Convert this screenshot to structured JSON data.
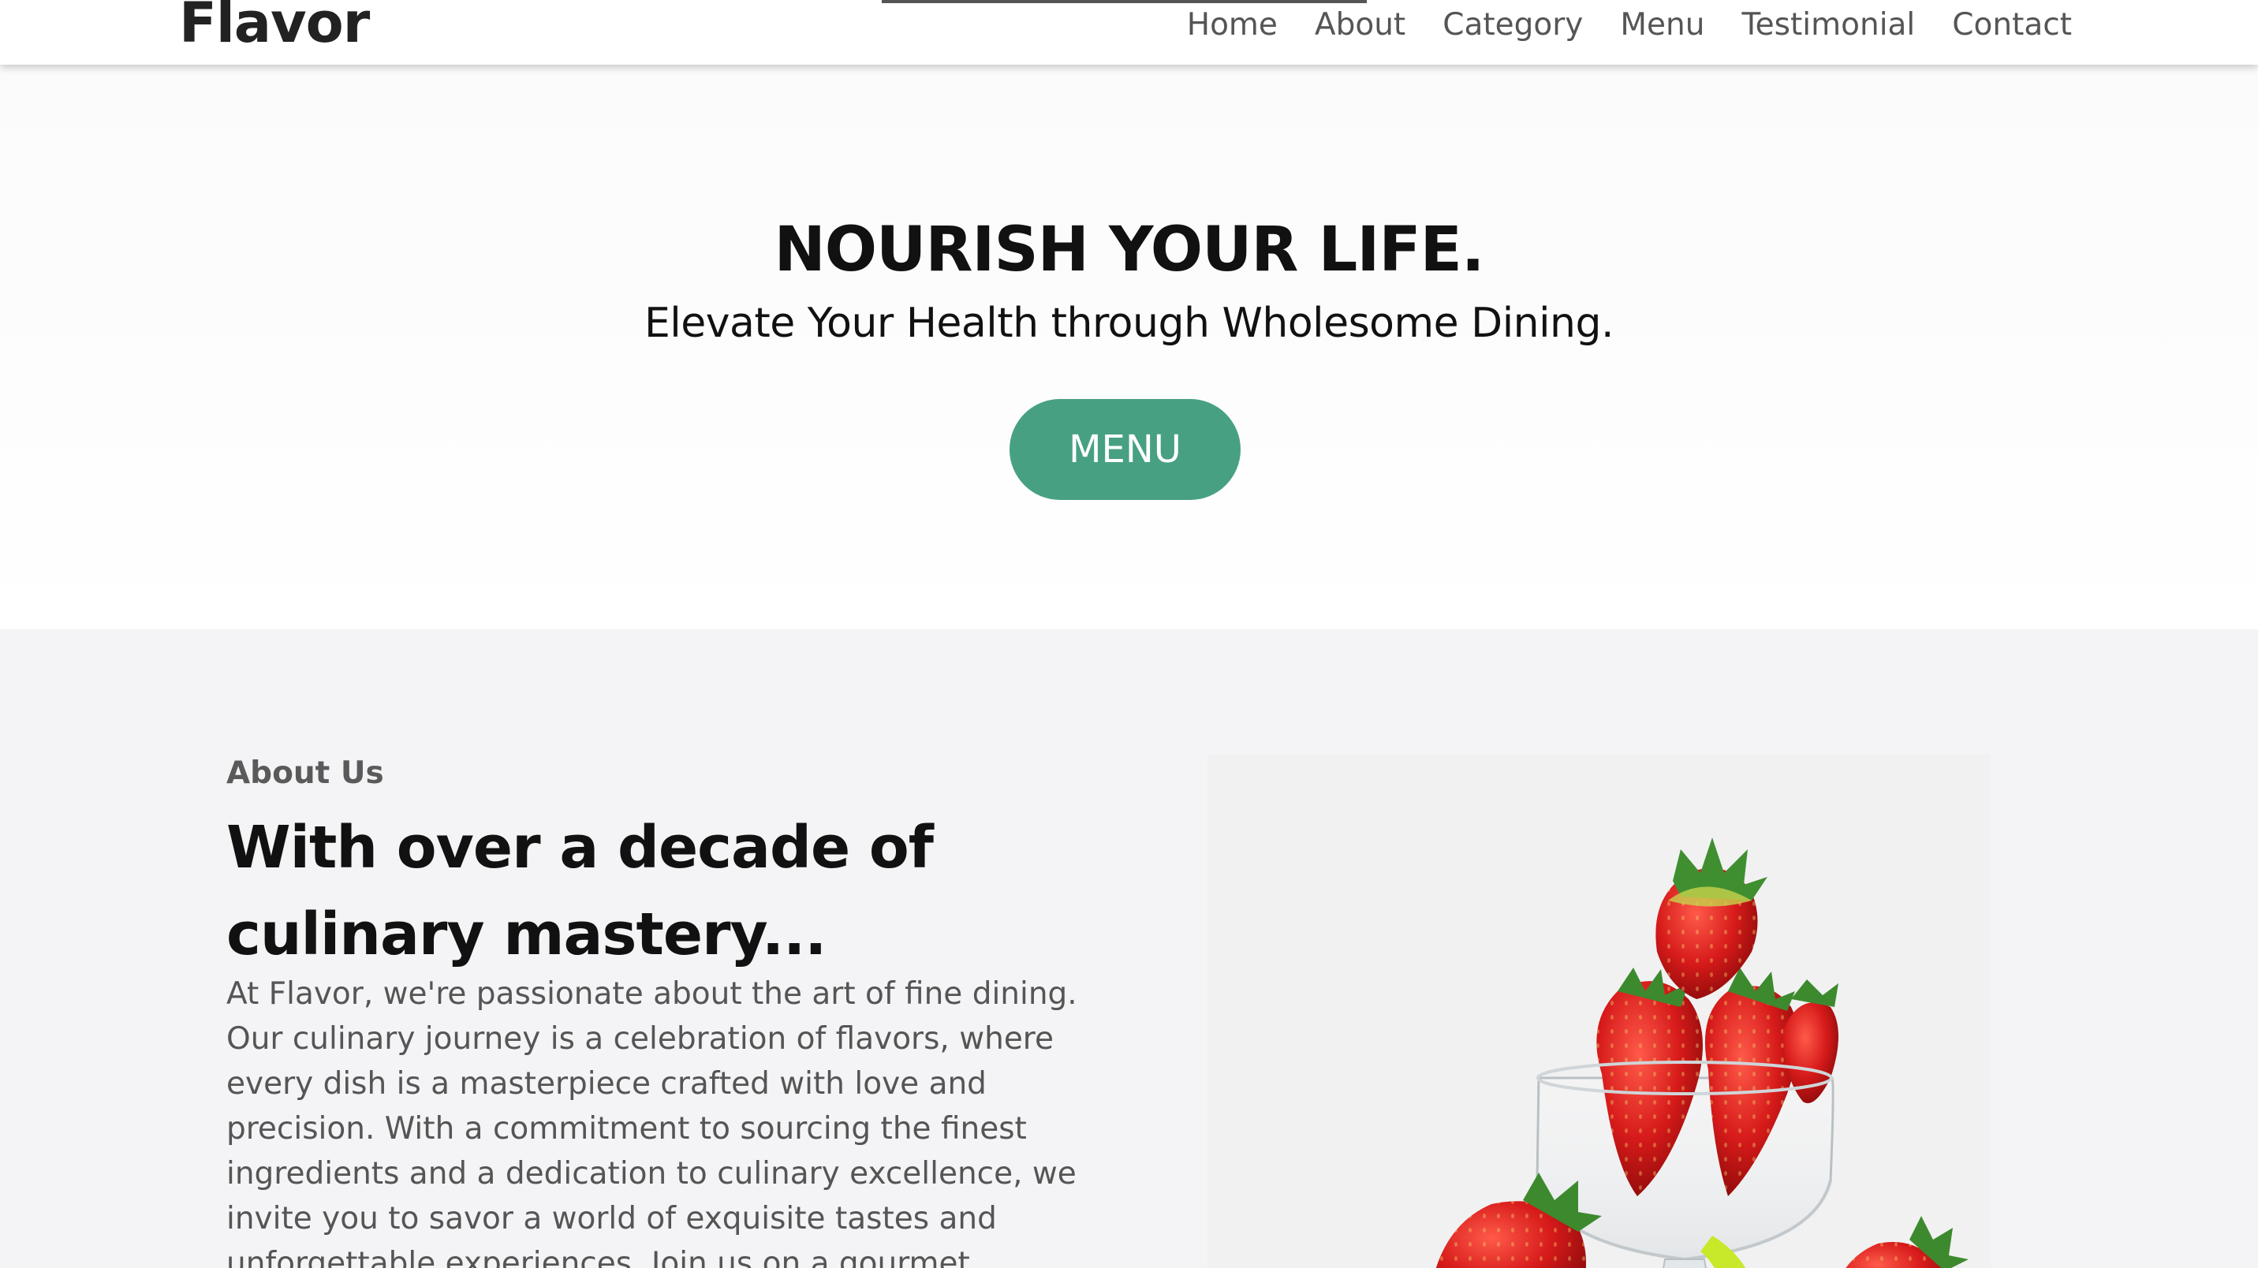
{
  "brand": {
    "logo": "Flavor"
  },
  "nav": {
    "items": [
      {
        "label": "Home"
      },
      {
        "label": "About"
      },
      {
        "label": "Category"
      },
      {
        "label": "Menu"
      },
      {
        "label": "Testimonial"
      },
      {
        "label": "Contact"
      }
    ]
  },
  "hero": {
    "title": "NOURISH YOUR LIFE.",
    "subtitle": "Elevate Your Health through Wholesome Dining.",
    "button_label": "MENU"
  },
  "about": {
    "eyebrow": "About Us",
    "heading": "With over a decade of culinary mastery...",
    "body": "At Flavor, we're passionate about the art of fine dining. Our culinary journey is a celebration of flavors, where every dish is a masterpiece crafted with love and precision. With a commitment to sourcing the finest ingredients and a dedication to culinary excellence, we invite you to savor a world of exquisite tastes and unforgettable experiences. Join us on a gourmet"
  },
  "colors": {
    "accent": "#48a083",
    "header_text": "#555555",
    "about_background": "#f4f4f6"
  },
  "icons": {
    "about_image": "strawberries-in-glass-image"
  }
}
